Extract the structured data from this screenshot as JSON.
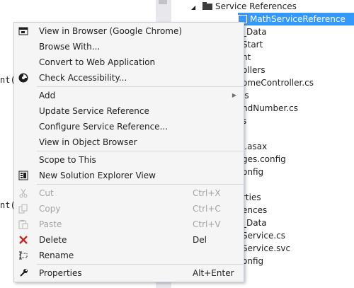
{
  "editor": {
    "fragments": [
      "nt(",
      "nt("
    ]
  },
  "explorer": {
    "rows": [
      {
        "text": "Service References",
        "indent": 0,
        "expanded": true,
        "folder": true
      },
      {
        "text": "MathServiceReference",
        "indent": 1,
        "selected": true
      },
      {
        "text": "_Data"
      },
      {
        "text": "Start"
      },
      {
        "text": "nt"
      },
      {
        "text": "ollers"
      },
      {
        "text": "omeController.cs"
      },
      {
        "text": "ls"
      },
      {
        "text": "ndNumber.cs"
      },
      {
        "text": "s"
      },
      {
        "text": ""
      },
      {
        "text": "l.asax"
      },
      {
        "text": "ges.config"
      },
      {
        "text": "onfig"
      },
      {
        "text": ""
      },
      {
        "text": "rties"
      },
      {
        "text": "ences"
      },
      {
        "text": "_Data"
      },
      {
        "text": "Service.cs"
      },
      {
        "text": "Service.svc"
      },
      {
        "text": "onfig"
      }
    ]
  },
  "menu": {
    "groups": [
      [
        {
          "label": "View in Browser (Google Chrome)",
          "icon": "browser-icon"
        },
        {
          "label": "Browse With...",
          "icon": ""
        },
        {
          "label": "Convert to Web Application",
          "icon": ""
        },
        {
          "label": "Check Accessibility...",
          "icon": "accessibility-icon"
        }
      ],
      [
        {
          "label": "Add",
          "icon": "",
          "submenu": true
        },
        {
          "label": "Update Service Reference",
          "icon": ""
        },
        {
          "label": "Configure Service Reference...",
          "icon": ""
        },
        {
          "label": "View in Object Browser",
          "icon": ""
        }
      ],
      [
        {
          "label": "Scope to This",
          "icon": ""
        },
        {
          "label": "New Solution Explorer View",
          "icon": "new-explorer-view-icon"
        }
      ],
      [
        {
          "label": "Cut",
          "icon": "cut-icon",
          "shortcut": "Ctrl+X",
          "disabled": true
        },
        {
          "label": "Copy",
          "icon": "copy-icon",
          "shortcut": "Ctrl+C",
          "disabled": true
        },
        {
          "label": "Paste",
          "icon": "paste-icon",
          "shortcut": "Ctrl+V",
          "disabled": true
        },
        {
          "label": "Delete",
          "icon": "delete-icon",
          "shortcut": "Del"
        },
        {
          "label": "Rename",
          "icon": "rename-icon"
        }
      ],
      [
        {
          "label": "Properties",
          "icon": "properties-icon",
          "shortcut": "Alt+Enter"
        }
      ]
    ]
  },
  "colors": {
    "selection": "#3399ff",
    "delete_red": "#c5281c",
    "menu_bg": "#f5f5f5",
    "disabled_text": "#a2a4a5"
  }
}
